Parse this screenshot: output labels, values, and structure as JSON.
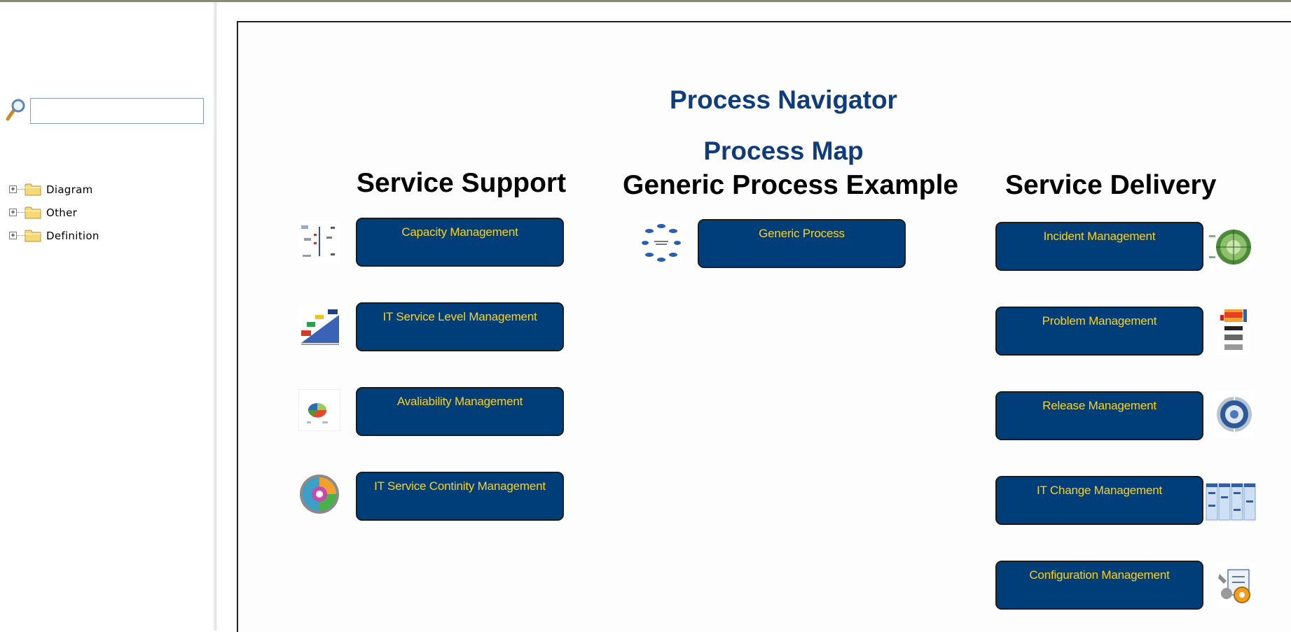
{
  "search": {
    "placeholder": "",
    "value": ""
  },
  "tree": [
    {
      "label": "Diagram",
      "expander": "+"
    },
    {
      "label": "Other",
      "expander": "+"
    },
    {
      "label": "Definition",
      "expander": "+"
    }
  ],
  "main": {
    "title": "Process Navigator",
    "subtitle": "Process Map",
    "columns": {
      "service_support": {
        "heading": "Service Support",
        "buttons": [
          "Capacity Management",
          "IT Service Level Management",
          "Avaliability Management",
          "IT Service Continity Management"
        ]
      },
      "generic": {
        "heading": "Generic Process Example",
        "buttons": [
          "Generic Process"
        ]
      },
      "service_delivery": {
        "heading": "Service Delivery",
        "buttons": [
          "Incident Management",
          "Problem Management",
          "Release Management",
          "IT Change Management",
          "Configuration Management"
        ]
      }
    }
  },
  "colors": {
    "title": "#0f3c7a",
    "button_fill": "#003e7a",
    "button_text": "#ffd11a"
  }
}
